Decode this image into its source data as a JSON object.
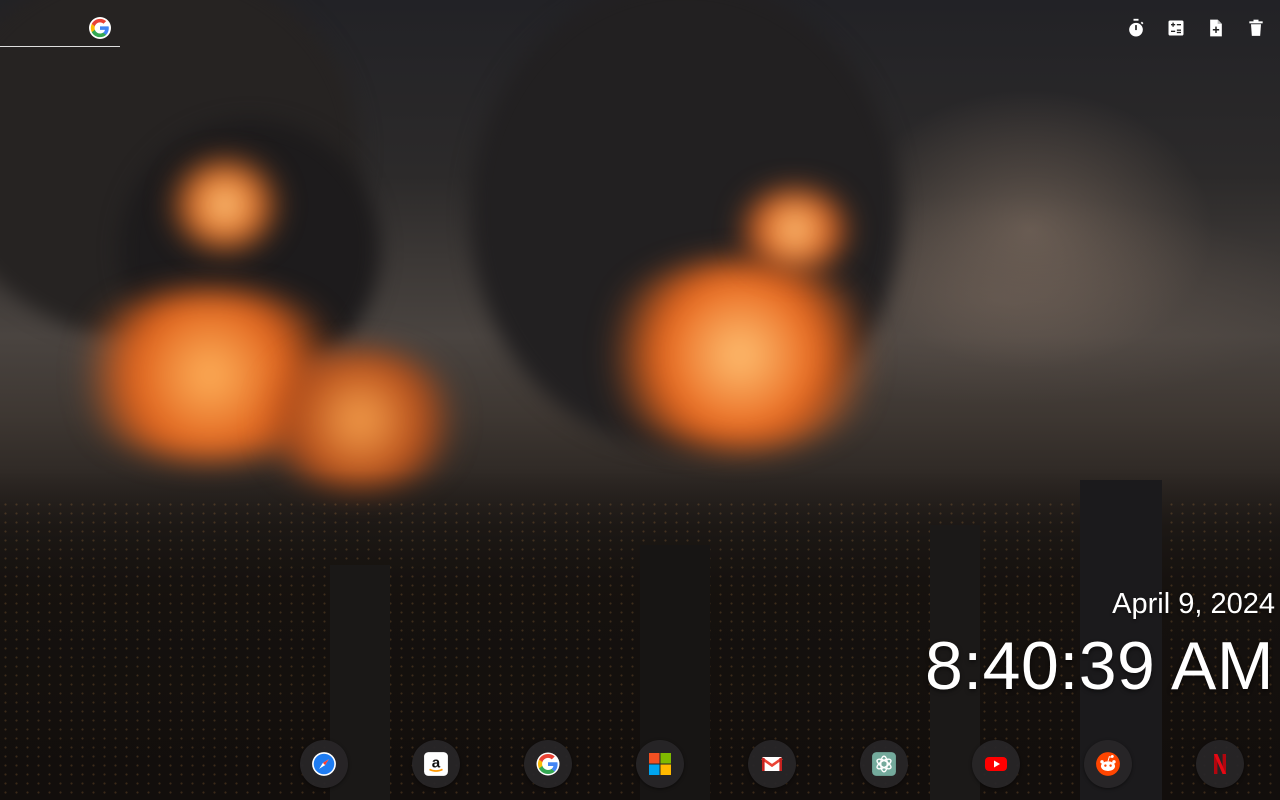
{
  "search": {
    "value": "",
    "placeholder": "",
    "engine_icon": "google-g-icon"
  },
  "toolbar": {
    "items": [
      {
        "name": "timer",
        "icon": "stopwatch-icon"
      },
      {
        "name": "calculator",
        "icon": "calculator-icon"
      },
      {
        "name": "new-note",
        "icon": "note-add-icon"
      },
      {
        "name": "delete",
        "icon": "trash-icon"
      }
    ]
  },
  "clock": {
    "date": "April 9, 2024",
    "time": "8:40:39 AM"
  },
  "dock": {
    "items": [
      {
        "name": "safari",
        "icon": "safari-compass-icon",
        "color": "#1e7cf2"
      },
      {
        "name": "amazon",
        "icon": "amazon-logo-icon",
        "color": "#ff9900"
      },
      {
        "name": "google",
        "icon": "google-g-icon",
        "color": "#4285f4"
      },
      {
        "name": "microsoft",
        "icon": "microsoft-logo-icon",
        "color": "#00a4ef"
      },
      {
        "name": "gmail",
        "icon": "gmail-envelope-icon",
        "color": "#ea4335"
      },
      {
        "name": "chatgpt",
        "icon": "openai-knot-icon",
        "color": "#74aa9c"
      },
      {
        "name": "youtube",
        "icon": "youtube-play-icon",
        "color": "#ff0000"
      },
      {
        "name": "reddit",
        "icon": "reddit-alien-icon",
        "color": "#ff4500"
      },
      {
        "name": "netflix",
        "icon": "netflix-n-icon",
        "color": "#e50914"
      }
    ]
  }
}
